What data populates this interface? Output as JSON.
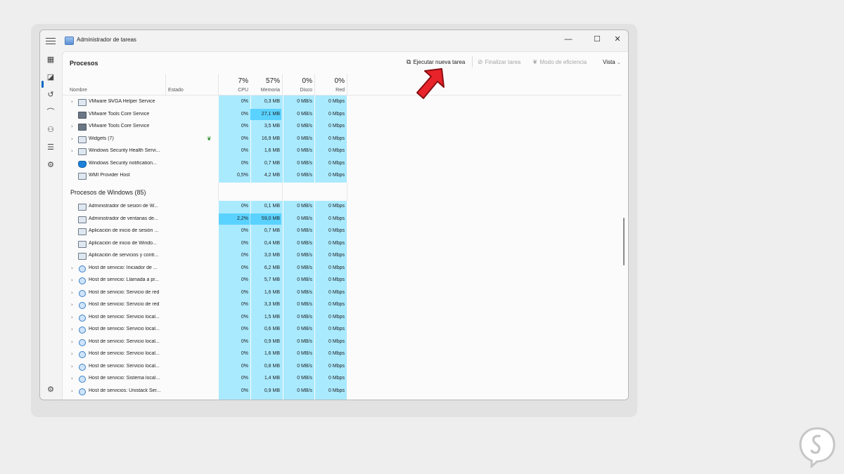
{
  "window": {
    "title": "Administrador de tareas",
    "minimize_glyph": "—",
    "maximize_glyph": "☐",
    "close_glyph": "✕"
  },
  "rail": {
    "icons": [
      "processes-icon",
      "performance-icon",
      "app-history-icon",
      "startup-icon",
      "users-icon",
      "details-icon",
      "services-icon",
      "settings-icon"
    ]
  },
  "header": {
    "section_title": "Procesos"
  },
  "toolbar": {
    "run_new_task": "Ejecutar nueva tarea",
    "end_task": "Finalizar tarea",
    "efficiency_mode": "Modo de eficiencia",
    "view": "Vista",
    "view_chevron": "⌄"
  },
  "columns": {
    "name": "Nombre",
    "status": "Estado",
    "cpu": {
      "pct": "7%",
      "label": "CPU"
    },
    "memory": {
      "pct": "57%",
      "label": "Memoria"
    },
    "disk": {
      "pct": "0%",
      "label": "Disco"
    },
    "network": {
      "pct": "0%",
      "label": "Red"
    }
  },
  "colors": {
    "heat_light": "#aaeaff",
    "heat_strong": "#5ad2ff",
    "accent": "#0067c0",
    "arrow": "#e8232a"
  },
  "rows_top": [
    {
      "name": "VMware SVGA Helper Service",
      "expand": true,
      "icon": "app",
      "cpu": "0%",
      "mem": "0,3 MB",
      "disk": "0 MB/s",
      "net": "0 Mbps"
    },
    {
      "name": "VMware Tools Core Service",
      "expand": false,
      "icon": "vm",
      "cpu": "0%",
      "mem": "27,1 MB",
      "disk": "0 MB/s",
      "net": "0 Mbps",
      "mem_hot": true
    },
    {
      "name": "VMware Tools Core Service",
      "expand": true,
      "icon": "vm",
      "cpu": "0%",
      "mem": "3,5 MB",
      "disk": "0 MB/s",
      "net": "0 Mbps"
    },
    {
      "name": "Widgets (7)",
      "expand": true,
      "icon": "app",
      "cpu": "0%",
      "mem": "16,9 MB",
      "disk": "0 MB/s",
      "net": "0 Mbps",
      "status_icon": true
    },
    {
      "name": "Windows Security Health Servi...",
      "expand": true,
      "icon": "app",
      "cpu": "0%",
      "mem": "1,6 MB",
      "disk": "0 MB/s",
      "net": "0 Mbps"
    },
    {
      "name": "Windows Security notification...",
      "expand": false,
      "icon": "shield",
      "cpu": "0%",
      "mem": "0,7 MB",
      "disk": "0 MB/s",
      "net": "0 Mbps"
    },
    {
      "name": "WMI Provider Host",
      "expand": false,
      "icon": "app",
      "cpu": "0,5%",
      "mem": "4,2 MB",
      "disk": "0 MB/s",
      "net": "0 Mbps"
    }
  ],
  "group_label": "Procesos de Windows (85)",
  "rows_win": [
    {
      "name": "Administrador de sesión de W...",
      "expand": false,
      "icon": "app",
      "cpu": "0%",
      "mem": "0,1 MB",
      "disk": "0 MB/s",
      "net": "0 Mbps"
    },
    {
      "name": "Administrador de ventanas de...",
      "expand": false,
      "icon": "app",
      "cpu": "2,2%",
      "mem": "59,0 MB",
      "disk": "0 MB/s",
      "net": "0 Mbps",
      "cpu_hot": true,
      "mem_hot": true
    },
    {
      "name": "Aplicación de inicio de sesión ...",
      "expand": false,
      "icon": "app",
      "cpu": "0%",
      "mem": "0,7 MB",
      "disk": "0 MB/s",
      "net": "0 Mbps"
    },
    {
      "name": "Aplicación de inicio de Windo...",
      "expand": false,
      "icon": "app",
      "cpu": "0%",
      "mem": "0,4 MB",
      "disk": "0 MB/s",
      "net": "0 Mbps"
    },
    {
      "name": "Aplicación de servicios y contr...",
      "expand": false,
      "icon": "app",
      "cpu": "0%",
      "mem": "3,0 MB",
      "disk": "0 MB/s",
      "net": "0 Mbps"
    },
    {
      "name": "Host de servicio: Iniciador de ...",
      "expand": true,
      "icon": "gear",
      "cpu": "0%",
      "mem": "6,2 MB",
      "disk": "0 MB/s",
      "net": "0 Mbps"
    },
    {
      "name": "Host de servicio: Llamada a pr...",
      "expand": true,
      "icon": "gear",
      "cpu": "0%",
      "mem": "5,7 MB",
      "disk": "0 MB/s",
      "net": "0 Mbps"
    },
    {
      "name": "Host de servicio: Servicio de red",
      "expand": true,
      "icon": "gear",
      "cpu": "0%",
      "mem": "1,6 MB",
      "disk": "0 MB/s",
      "net": "0 Mbps"
    },
    {
      "name": "Host de servicio: Servicio de red",
      "expand": true,
      "icon": "gear",
      "cpu": "0%",
      "mem": "3,3 MB",
      "disk": "0 MB/s",
      "net": "0 Mbps"
    },
    {
      "name": "Host de servicio: Servicio local...",
      "expand": true,
      "icon": "gear",
      "cpu": "0%",
      "mem": "1,5 MB",
      "disk": "0 MB/s",
      "net": "0 Mbps"
    },
    {
      "name": "Host de servicio: Servicio local...",
      "expand": true,
      "icon": "gear",
      "cpu": "0%",
      "mem": "0,6 MB",
      "disk": "0 MB/s",
      "net": "0 Mbps"
    },
    {
      "name": "Host de servicio: Servicio local...",
      "expand": true,
      "icon": "gear",
      "cpu": "0%",
      "mem": "0,9 MB",
      "disk": "0 MB/s",
      "net": "0 Mbps"
    },
    {
      "name": "Host de servicio: Servicio local...",
      "expand": true,
      "icon": "gear",
      "cpu": "0%",
      "mem": "1,6 MB",
      "disk": "0 MB/s",
      "net": "0 Mbps"
    },
    {
      "name": "Host de servicio: Servicio local...",
      "expand": true,
      "icon": "gear",
      "cpu": "0%",
      "mem": "0,8 MB",
      "disk": "0 MB/s",
      "net": "0 Mbps"
    },
    {
      "name": "Host de servicio: Sistema local...",
      "expand": true,
      "icon": "gear",
      "cpu": "0%",
      "mem": "1,4 MB",
      "disk": "0 MB/s",
      "net": "0 Mbps"
    },
    {
      "name": "Host de servicios: Unistack Ser...",
      "expand": true,
      "icon": "gear",
      "cpu": "0%",
      "mem": "0,9 MB",
      "disk": "0 MB/s",
      "net": "0 Mbps"
    }
  ]
}
